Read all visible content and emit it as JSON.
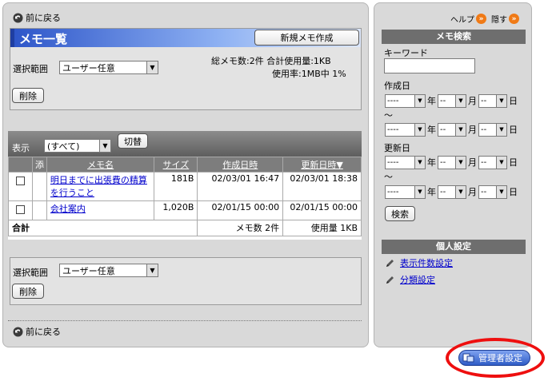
{
  "nav": {
    "back_label": "前に戻る"
  },
  "memo_list": {
    "title": "メモ一覧",
    "new_button": "新規メモ作成",
    "scope_label": "選択範囲",
    "scope_value": "ユーザー任意",
    "delete_button": "削除",
    "summary_line1": "総メモ数:2件 合計使用量:1KB",
    "summary_line2": "使用率:1MB中 1%"
  },
  "filter": {
    "display_label": "表示",
    "display_value": "(すべて)",
    "switch_button": "切替"
  },
  "table": {
    "headers": {
      "attach": "添",
      "name": "メモ名",
      "size": "サイズ",
      "created": "作成日時",
      "updated": "更新日時▼"
    },
    "rows": [
      {
        "name": "明日までに出張費の精算を行うこと",
        "size": "181B",
        "created": "02/03/01 16:47",
        "updated": "02/03/01 18:38"
      },
      {
        "name": "会社案内",
        "size": "1,020B",
        "created": "02/01/15 00:00",
        "updated": "02/01/15 00:00"
      }
    ],
    "total_label": "合計",
    "total_count": "メモ数 2件",
    "total_usage": "使用量 1KB"
  },
  "bottom_action": {
    "scope_label": "選択範囲",
    "scope_value": "ユーザー任意",
    "delete_button": "削除"
  },
  "side": {
    "help_label": "ヘルプ",
    "hide_label": "隠す",
    "search_title": "メモ検索",
    "keyword_label": "キーワード",
    "keyword_value": "",
    "created_label": "作成日",
    "updated_label": "更新日",
    "tilde": "～",
    "year_placeholder": "----",
    "md_placeholder": "--",
    "year_unit": "年",
    "month_unit": "月",
    "day_unit": "日",
    "search_button": "検索",
    "personal_title": "個人設定",
    "display_count_link": "表示件数設定",
    "category_link": "分類設定"
  },
  "admin": {
    "button_label": "管理者設定"
  },
  "colors": {
    "accent_blue": "#2e56c9",
    "highlight_red": "#ee0f0f",
    "panel_gray": "#d9d9d9"
  }
}
